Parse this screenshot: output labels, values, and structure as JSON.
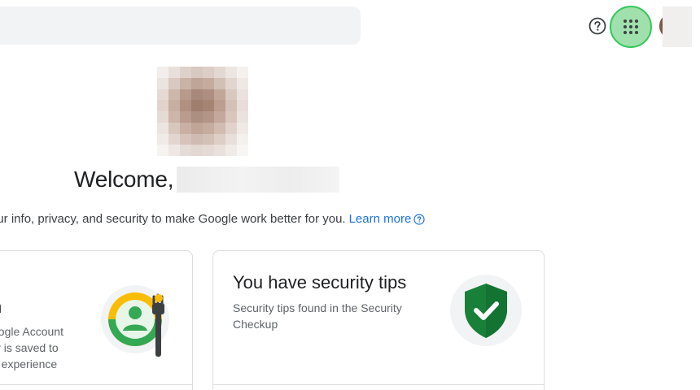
{
  "header": {
    "search_placeholder": "",
    "help_icon": "help-circle-icon",
    "apps_icon": "apps-grid-icon",
    "avatar_icon": "account-avatar-icon"
  },
  "profile": {
    "welcome_text": "Welcome,",
    "intro_text": "our info, privacy, and security to make Google work better for you.",
    "learn_more_label": "Learn more",
    "learn_more_icon": "info-circle-icon"
  },
  "cards": {
    "privacy": {
      "title": "n",
      "desc_line1": "oogle Account",
      "desc_line2": "ty is saved to",
      "desc_line3": "e experience",
      "illustration": "privacy-personalization-icon"
    },
    "security": {
      "title": "You have security tips",
      "description": "Security tips found in the Security Checkup",
      "illustration": "security-shield-check-icon"
    }
  },
  "colors": {
    "accent_blue": "#1a73e8",
    "apps_button_bg": "#9fe0ac",
    "apps_button_border": "#34c759",
    "shield_green": "#188038",
    "search_bg": "#f1f3f4"
  }
}
